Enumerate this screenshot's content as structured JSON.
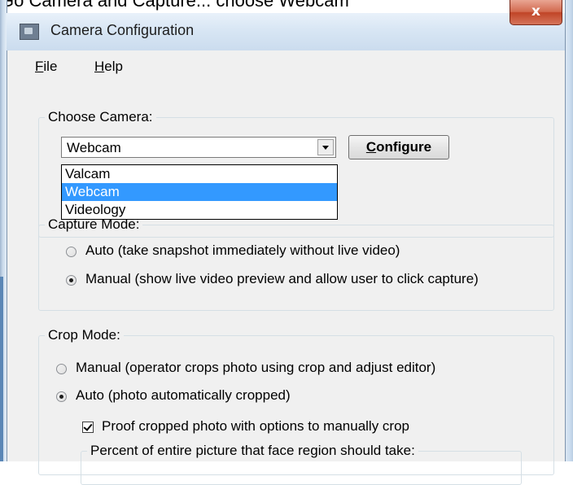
{
  "document_text": "Go Camera and Capture... choose Webcam",
  "window": {
    "title": "Camera Configuration",
    "close_label": "x"
  },
  "menu": {
    "file": {
      "mnemonic": "F",
      "rest": "ile"
    },
    "help": {
      "mnemonic": "H",
      "rest": "elp"
    }
  },
  "choose_camera": {
    "legend": "Choose Camera:",
    "selected": "Webcam",
    "options": [
      "Valcam",
      "Webcam",
      "Videology"
    ],
    "selected_index": 1,
    "configure_label": {
      "mnemonic": "C",
      "rest": "onfigure"
    }
  },
  "capture_mode": {
    "legend": "Capture Mode:",
    "options": [
      {
        "label": "Auto (take snapshot immediately without live video)",
        "checked": false
      },
      {
        "label": "Manual (show live video preview and allow user to click capture)",
        "checked": true
      }
    ]
  },
  "crop_mode": {
    "legend": "Crop Mode:",
    "options": [
      {
        "label": "Manual (operator crops photo using crop and adjust editor)",
        "checked": false
      },
      {
        "label": "Auto (photo automatically cropped)",
        "checked": true
      }
    ],
    "proof_checkbox": {
      "label": "Proof cropped photo with options to manually crop",
      "checked": true
    },
    "percent_legend": "Percent of entire picture that face region should take:"
  },
  "colors": {
    "selection": "#3399ff",
    "close_button": "#c9553a",
    "titlebar": "#d8e6f4"
  }
}
